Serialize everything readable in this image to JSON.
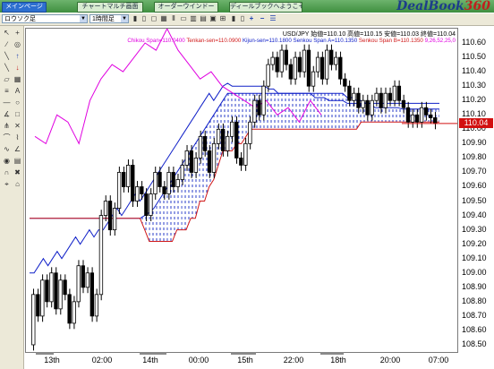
{
  "tabs": [
    {
      "label": "メインページ",
      "active": true
    },
    {
      "label": "チャートマルチ画面",
      "active": false
    },
    {
      "label": "オーダーウインドー",
      "active": false
    },
    {
      "label": "ディールブックへようこそ",
      "active": false
    }
  ],
  "logo": {
    "text": "DealBook",
    "num": "360"
  },
  "toolbar": {
    "chart_type": "ロウソク足",
    "period": "1時間足"
  },
  "header": {
    "quote": "USD/JPY 始値=110.10 高値=110.15 安値=110.03 終値=110.04",
    "chikou": "Chikou Span=110.0400",
    "tenkan": "Tenkan-sen=110.0900",
    "kijun": "Kijun-sen=110.1800",
    "senkou_a": "Senkou Span A=110.1350",
    "senkou_b": "Senkou Span B=110.1350",
    "time": "9,26,52,25,0"
  },
  "colors": {
    "chikou": "#e000e0",
    "tenkan": "#d01818",
    "kijun": "#1020c8",
    "cloud_bull": "#2030c0",
    "cloud_bear": "#d01818",
    "price_box": "#d21010"
  },
  "price_box": "110.04",
  "chart_data": {
    "type": "candlestick",
    "ylim": [
      108.45,
      110.7
    ],
    "y_ticks": [
      "110.60",
      "110.50",
      "110.40",
      "110.30",
      "110.20",
      "110.10",
      "110.00",
      "109.90",
      "109.80",
      "109.70",
      "109.60",
      "109.50",
      "109.40",
      "109.30",
      "109.20",
      "109.10",
      "109.00",
      "108.90",
      "108.80",
      "108.70",
      "108.60",
      "108.50"
    ],
    "x_labels": [
      "13th",
      "02:00",
      "14th",
      "00:00",
      "15th",
      "22:00",
      "18th",
      "20:00",
      "07:00"
    ],
    "last_price": 110.04,
    "candles": [
      [
        108.5,
        108.85
      ],
      [
        108.85,
        108.7
      ],
      [
        108.7,
        108.95
      ],
      [
        108.95,
        108.8
      ],
      [
        108.8,
        109.0
      ],
      [
        109.0,
        108.75
      ],
      [
        108.75,
        108.95
      ],
      [
        108.95,
        108.85
      ],
      [
        108.85,
        108.65
      ],
      [
        108.65,
        108.8
      ],
      [
        108.8,
        109.05
      ],
      [
        109.05,
        108.9
      ],
      [
        108.9,
        109.0
      ],
      [
        109.0,
        108.7
      ],
      [
        108.7,
        108.85
      ],
      [
        108.85,
        109.4
      ],
      [
        109.4,
        109.5
      ],
      [
        109.5,
        109.3
      ],
      [
        109.3,
        109.45
      ],
      [
        109.45,
        109.7
      ],
      [
        109.7,
        109.6
      ],
      [
        109.6,
        109.75
      ],
      [
        109.75,
        109.5
      ],
      [
        109.5,
        109.6
      ],
      [
        109.6,
        109.55
      ],
      [
        109.55,
        109.4
      ],
      [
        109.4,
        109.55
      ],
      [
        109.55,
        109.7
      ],
      [
        109.7,
        109.6
      ],
      [
        109.6,
        109.55
      ],
      [
        109.55,
        109.7
      ],
      [
        109.7,
        109.6
      ],
      [
        109.6,
        109.65
      ],
      [
        109.65,
        109.75
      ],
      [
        109.75,
        109.85
      ],
      [
        109.85,
        109.7
      ],
      [
        109.7,
        109.8
      ],
      [
        109.8,
        109.95
      ],
      [
        109.95,
        109.85
      ],
      [
        109.85,
        109.7
      ],
      [
        109.7,
        109.9
      ],
      [
        109.9,
        110.0
      ],
      [
        110.0,
        109.85
      ],
      [
        109.85,
        109.95
      ],
      [
        109.95,
        110.05
      ],
      [
        110.05,
        109.8
      ],
      [
        109.8,
        109.75
      ],
      [
        109.75,
        109.9
      ],
      [
        109.9,
        110.05
      ],
      [
        110.05,
        110.2
      ],
      [
        110.2,
        110.1
      ],
      [
        110.1,
        110.3
      ],
      [
        110.3,
        110.45
      ],
      [
        110.45,
        110.5
      ],
      [
        110.5,
        110.4
      ],
      [
        110.4,
        110.55
      ],
      [
        110.55,
        110.45
      ],
      [
        110.45,
        110.35
      ],
      [
        110.35,
        110.5
      ],
      [
        110.5,
        110.4
      ],
      [
        110.4,
        110.55
      ],
      [
        110.55,
        110.3
      ],
      [
        110.3,
        110.4
      ],
      [
        110.4,
        110.5
      ],
      [
        110.5,
        110.35
      ],
      [
        110.35,
        110.55
      ],
      [
        110.55,
        110.45
      ],
      [
        110.45,
        110.5
      ],
      [
        110.5,
        110.35
      ],
      [
        110.35,
        110.3
      ],
      [
        110.3,
        110.2
      ],
      [
        110.2,
        110.25
      ],
      [
        110.25,
        110.15
      ],
      [
        110.15,
        110.2
      ],
      [
        110.2,
        110.1
      ],
      [
        110.1,
        110.2
      ],
      [
        110.2,
        110.25
      ],
      [
        110.25,
        110.15
      ],
      [
        110.15,
        110.25
      ],
      [
        110.25,
        110.2
      ],
      [
        110.2,
        110.3
      ],
      [
        110.3,
        110.2
      ],
      [
        110.2,
        110.15
      ],
      [
        110.15,
        110.05
      ],
      [
        110.05,
        110.1
      ],
      [
        110.1,
        110.05
      ],
      [
        110.05,
        110.15
      ],
      [
        110.15,
        110.1
      ],
      [
        110.1,
        110.08
      ],
      [
        110.08,
        110.04
      ]
    ],
    "chikou": [
      109.95,
      109.9,
      110.1,
      110.05,
      109.9,
      110.2,
      110.35,
      110.45,
      110.4,
      110.5,
      110.6,
      110.55,
      110.7,
      110.55,
      110.45,
      110.35,
      110.4,
      110.3,
      110.25,
      110.2,
      110.15,
      110.2,
      110.1,
      110.15,
      110.05,
      110.2,
      110.1
    ],
    "tenkan": [
      109.38,
      109.38,
      109.38,
      109.38,
      109.38,
      109.38,
      109.38,
      109.38,
      109.38,
      109.38,
      109.38,
      109.38,
      109.38,
      109.38,
      109.38,
      109.38,
      109.38,
      109.38,
      109.5,
      109.5,
      109.45,
      109.45,
      109.4,
      109.4,
      109.42,
      109.42,
      109.45,
      109.45,
      109.55,
      109.55,
      109.7,
      109.7,
      109.78,
      109.78,
      109.85,
      109.85,
      109.95,
      109.95,
      110.0,
      110.0,
      110.1,
      110.1,
      110.15,
      110.15,
      110.18,
      110.18,
      110.22,
      110.22,
      110.25,
      110.25,
      110.28,
      110.28,
      110.3,
      110.3,
      110.32,
      110.32,
      110.35,
      110.35,
      110.38,
      110.38,
      110.4,
      110.4,
      110.42,
      110.42,
      110.45,
      110.45,
      110.48,
      110.48,
      110.5,
      110.5,
      110.52,
      110.52,
      110.5,
      110.5,
      110.45,
      110.45,
      110.4,
      110.4,
      110.35,
      110.35,
      110.3,
      110.3,
      110.25,
      110.25,
      110.2,
      110.2,
      110.15,
      110.15,
      110.1,
      110.1
    ],
    "kijun": [
      109.0,
      109.0,
      109.05,
      109.1,
      109.05,
      109.1,
      109.15,
      109.1,
      109.15,
      109.2,
      109.25,
      109.2,
      109.25,
      109.3,
      109.25,
      109.3,
      109.3,
      109.35,
      109.4,
      109.45,
      109.4,
      109.45,
      109.5,
      109.55,
      109.5,
      109.55,
      109.6,
      109.65,
      109.7,
      109.75,
      109.8,
      109.85,
      109.9,
      109.95,
      110.0,
      110.05,
      110.1,
      110.15,
      110.2,
      110.25,
      110.2,
      110.25,
      110.3,
      110.32,
      110.3,
      110.3,
      110.3,
      110.3,
      110.3,
      110.3,
      110.3,
      110.3,
      110.28,
      110.28,
      110.25,
      110.25,
      110.25,
      110.25,
      110.25,
      110.25,
      110.25,
      110.25,
      110.22,
      110.22,
      110.22,
      110.2,
      110.2,
      110.2,
      110.2,
      110.18,
      110.18,
      110.18,
      110.18,
      110.18,
      110.18,
      110.18,
      110.18,
      110.18,
      110.18,
      110.18,
      110.18,
      110.18,
      110.18,
      110.18,
      110.18,
      110.18,
      110.18,
      110.18,
      110.18,
      110.18
    ],
    "senkou_a": [
      109.38,
      109.38,
      109.38,
      109.38,
      109.38,
      109.38,
      109.38,
      109.38,
      109.38,
      109.38,
      109.38,
      109.38,
      109.38,
      109.38,
      109.38,
      109.38,
      109.38,
      109.38,
      109.38,
      109.38,
      109.38,
      109.38,
      109.38,
      109.38,
      109.38,
      109.4,
      109.42,
      109.45,
      109.5,
      109.55,
      109.6,
      109.65,
      109.7,
      109.75,
      109.8,
      109.85,
      109.9,
      109.95,
      110.0,
      110.05,
      110.1,
      110.15,
      110.2,
      110.25,
      110.25,
      110.25,
      110.25,
      110.25,
      110.25,
      110.25,
      110.25,
      110.25,
      110.25,
      110.25,
      110.25,
      110.25,
      110.25,
      110.25,
      110.25,
      110.25,
      110.25,
      110.25,
      110.25,
      110.25,
      110.25,
      110.25,
      110.25,
      110.25,
      110.25,
      110.22,
      110.22,
      110.2,
      110.2,
      110.18,
      110.18,
      110.15,
      110.15,
      110.15,
      110.15,
      110.15,
      110.15,
      110.14,
      110.14,
      110.14,
      110.14,
      110.14,
      110.14,
      110.14,
      110.14,
      110.14
    ],
    "senkou_b": [
      109.38,
      109.38,
      109.38,
      109.38,
      109.38,
      109.38,
      109.38,
      109.38,
      109.38,
      109.38,
      109.38,
      109.38,
      109.38,
      109.38,
      109.38,
      109.38,
      109.38,
      109.38,
      109.38,
      109.38,
      109.38,
      109.38,
      109.38,
      109.38,
      109.38,
      109.3,
      109.22,
      109.22,
      109.22,
      109.22,
      109.22,
      109.22,
      109.3,
      109.3,
      109.3,
      109.38,
      109.38,
      109.5,
      109.5,
      109.6,
      109.65,
      109.75,
      109.85,
      109.85,
      109.85,
      109.9,
      109.9,
      109.95,
      110.0,
      110.0,
      110.0,
      110.0,
      110.0,
      110.0,
      110.0,
      110.0,
      110.0,
      110.0,
      110.0,
      110.0,
      110.0,
      110.0,
      110.0,
      110.0,
      110.0,
      110.0,
      110.0,
      110.0,
      110.0,
      110.0,
      110.0,
      110.0,
      110.05,
      110.05,
      110.05,
      110.05,
      110.05,
      110.05,
      110.05,
      110.05,
      110.05,
      110.05,
      110.05,
      110.05,
      110.05,
      110.05,
      110.05,
      110.05,
      110.05,
      110.05
    ]
  }
}
